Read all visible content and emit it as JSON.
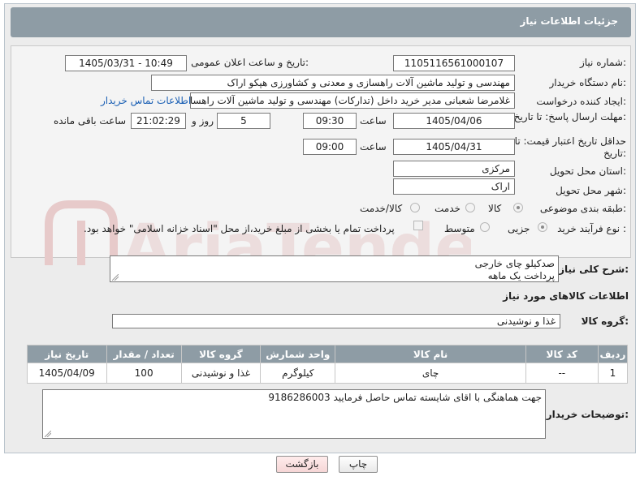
{
  "header": {
    "title": "جزئیات اطلاعات نیاز"
  },
  "labels": {
    "need_number": "شماره نیاز:",
    "announce_datetime": "تاریخ و ساعت اعلان عمومی:",
    "buyer_org": "نام دستگاه خریدار:",
    "requester": "ایجاد کننده درخواست:",
    "deadline": "مهلت ارسال پاسخ: تا تاریخ:",
    "min_price_validity": "حداقل تاریخ اعتبار قیمت: تا تاریخ:",
    "delivery_province": "استان محل تحویل:",
    "delivery_city": "شهر محل تحویل:",
    "category": "طبقه بندی موضوعی:",
    "process_type": "نوع فرآیند خرید :",
    "time": "ساعت",
    "day_and": "روز و",
    "remaining": "ساعت باقی مانده"
  },
  "fields": {
    "need_number": "1105116561000107",
    "announce_datetime": "1405/03/31 - 10:49",
    "buyer_org": "مهندسی و تولید ماشین آلات راهسازی و معدنی و کشاورزی هپکو اراک",
    "requester": "غلامرضا شعبانی مدیر خرید داخل (تدارکات) مهندسی و تولید ماشین آلات راهسازی",
    "buyer_contact_link": "اطلاعات تماس خریدار",
    "deadline_date": "1405/04/06",
    "deadline_time": "09:30",
    "days_left": "5",
    "time_left": "21:02:29",
    "validity_date": "1405/04/31",
    "validity_time": "09:00",
    "province": "مرکزی",
    "city": "اراک"
  },
  "category_options": [
    {
      "label": "کالا",
      "selected": true
    },
    {
      "label": "خدمت",
      "selected": false
    },
    {
      "label": "کالا/خدمت",
      "selected": false
    }
  ],
  "process_options": [
    {
      "label": "جزیی",
      "selected": true
    },
    {
      "label": "متوسط",
      "selected": false
    }
  ],
  "process_note": "پرداخت تمام یا بخشی از مبلغ خرید،از محل \"اسناد خزانه اسلامی\" خواهد بود.",
  "description": {
    "label": "شرح کلی نیاز:",
    "line1": "صدکیلو چای خارجی",
    "line2": "پرداخت یک ماهه"
  },
  "goods_info": {
    "title": "اطلاعات کالاهای مورد نیاز"
  },
  "goods_group": {
    "label": "گروه کالا:",
    "value": "غذا و نوشیدنی"
  },
  "table": {
    "headers": [
      "ردیف",
      "کد کالا",
      "نام کالا",
      "واحد شمارش",
      "گروه کالا",
      "تعداد / مقدار",
      "تاریخ نیاز"
    ],
    "rows": [
      [
        "1",
        "--",
        "چای",
        "کیلوگرم",
        "غذا و نوشیدنی",
        "100",
        "1405/04/09"
      ]
    ]
  },
  "buyer_notes": {
    "label": "توضیحات خریدار:",
    "text": "جهت هماهنگی با  اقای شایسته تماس حاصل فرمایید 9186286003"
  },
  "buttons": {
    "print": "چاپ",
    "back": "بازگشت"
  },
  "watermark": {
    "text": "AriaTender.net"
  },
  "colors": {
    "header_bg": "#8e9ca5",
    "link": "#1a5fb4",
    "back_button": "#f6d6d6"
  }
}
